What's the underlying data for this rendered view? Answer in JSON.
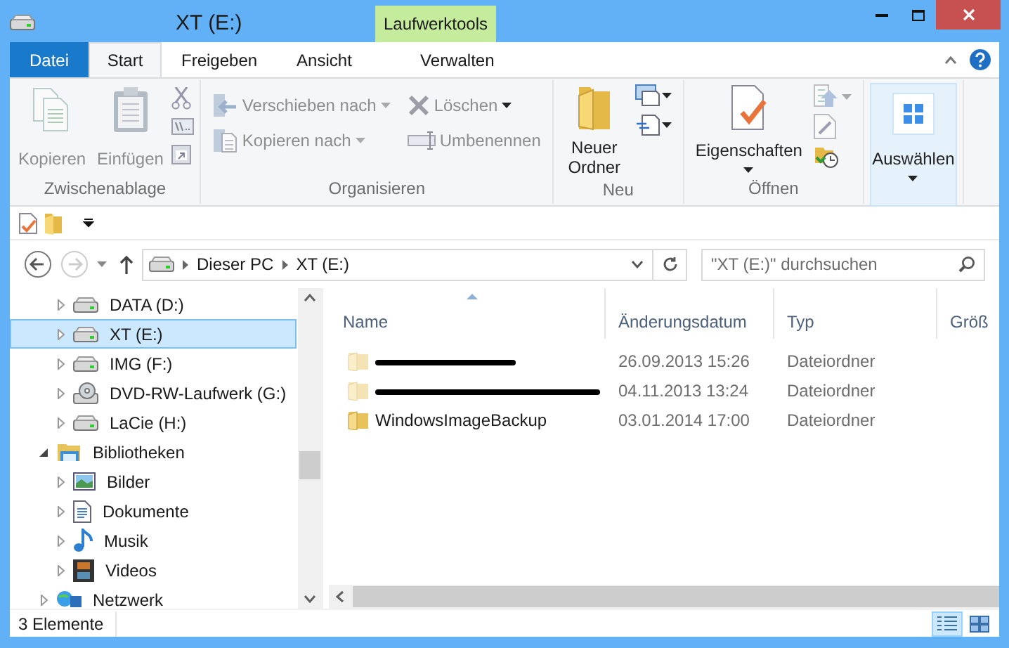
{
  "window": {
    "title": "XT (E:)",
    "context_group": "Laufwerktools"
  },
  "tabs": [
    {
      "label": "Datei",
      "kind": "file",
      "selected": false
    },
    {
      "label": "Start",
      "kind": "tab",
      "selected": true
    },
    {
      "label": "Freigeben",
      "kind": "tab",
      "selected": false
    },
    {
      "label": "Ansicht",
      "kind": "tab",
      "selected": false
    },
    {
      "label": "Verwalten",
      "kind": "context",
      "selected": false
    }
  ],
  "ribbon": {
    "groups": [
      {
        "label": "Zwischenablage",
        "buttons": [
          {
            "label": "Kopieren",
            "disabled": true
          },
          {
            "label": "Einfügen",
            "disabled": true
          }
        ]
      },
      {
        "label": "Organisieren",
        "buttons": [
          {
            "label": "Verschieben nach",
            "disabled": true,
            "dropdown": true
          },
          {
            "label": "Kopieren nach",
            "disabled": true,
            "dropdown": true
          },
          {
            "label": "Löschen",
            "disabled": true,
            "dropdown": true
          },
          {
            "label": "Umbenennen",
            "disabled": true,
            "dropdown": false
          }
        ]
      },
      {
        "label": "Neu",
        "buttons": [
          {
            "label": "Neuer Ordner",
            "disabled": false
          }
        ]
      },
      {
        "label": "Öffnen",
        "buttons": [
          {
            "label": "Eigenschaften",
            "disabled": false,
            "dropdown": true
          }
        ]
      },
      {
        "buttons": [
          {
            "label": "Auswählen",
            "disabled": false,
            "dropdown": true,
            "highlighted": true
          }
        ]
      }
    ]
  },
  "address": {
    "crumbs": [
      "Dieser PC",
      "XT (E:)"
    ],
    "search_placeholder": "\"XT (E:)\" durchsuchen"
  },
  "nav_tree": [
    {
      "children": [
        {
          "label": "DATA (D:)",
          "kind": "drive",
          "expanded": false,
          "selected": false
        },
        {
          "label": "XT (E:)",
          "kind": "drive",
          "expanded": false,
          "selected": true
        },
        {
          "label": "IMG (F:)",
          "kind": "drive",
          "expanded": false,
          "selected": false
        },
        {
          "label": "DVD-RW-Laufwerk (G:)",
          "kind": "dvd",
          "expanded": false,
          "selected": false
        },
        {
          "label": "LaCie (H:)",
          "kind": "drive",
          "expanded": false,
          "selected": false
        }
      ]
    },
    {
      "label": "Bibliotheken",
      "kind": "library",
      "expanded": true,
      "selected": false,
      "children": [
        {
          "label": "Bilder",
          "kind": "pictures",
          "expanded": false,
          "selected": false
        },
        {
          "label": "Dokumente",
          "kind": "documents",
          "expanded": false,
          "selected": false
        },
        {
          "label": "Musik",
          "kind": "music",
          "expanded": false,
          "selected": false
        },
        {
          "label": "Videos",
          "kind": "videos",
          "expanded": false,
          "selected": false
        }
      ]
    },
    {
      "label": "Netzwerk",
      "kind": "network",
      "expanded": false,
      "selected": false
    }
  ],
  "files": {
    "columns": [
      "Name",
      "Änderungsdatum",
      "Typ",
      "Größ"
    ],
    "rows": [
      {
        "date": "26.09.2013 15:26",
        "type": "Dateiordner",
        "hidden": true,
        "redacted": true
      },
      {
        "date": "04.11.2013 13:24",
        "type": "Dateiordner",
        "hidden": true,
        "redacted": true
      },
      {
        "name": "WindowsImageBackup",
        "date": "03.01.2014 17:00",
        "type": "Dateiordner",
        "hidden": false,
        "redacted": false
      }
    ]
  },
  "status_bar": {
    "count": "3 Elemente",
    "views": [
      {
        "kind": "details",
        "selected": true
      },
      {
        "kind": "icons",
        "selected": false
      }
    ]
  }
}
